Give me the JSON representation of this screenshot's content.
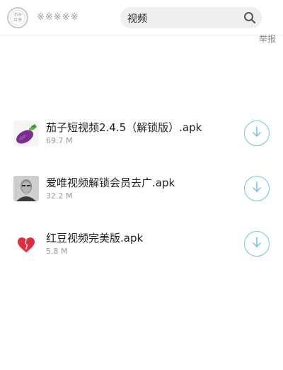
{
  "header": {
    "logo_line1": "沛市",
    "logo_line2": "共享",
    "site_name": "※※※※※",
    "search_value": "视频",
    "search_icon": "search-icon",
    "report_label": "举报"
  },
  "files": [
    {
      "name": "茄子短视频2.4.5（解锁版）.apk",
      "size": "69.7 M",
      "icon": "eggplant-icon",
      "download_icon": "download-icon"
    },
    {
      "name": "爱唯视频解锁会员去广.apk",
      "size": "32.2 M",
      "icon": "portrait-icon",
      "download_icon": "download-icon"
    },
    {
      "name": "红豆视频完美版.apk",
      "size": "5.8 M",
      "icon": "heart-icon",
      "download_icon": "download-icon"
    }
  ],
  "colors": {
    "accent": "#6ec4e8",
    "muted_text": "#9a9a9a",
    "search_bg": "#efefef"
  }
}
